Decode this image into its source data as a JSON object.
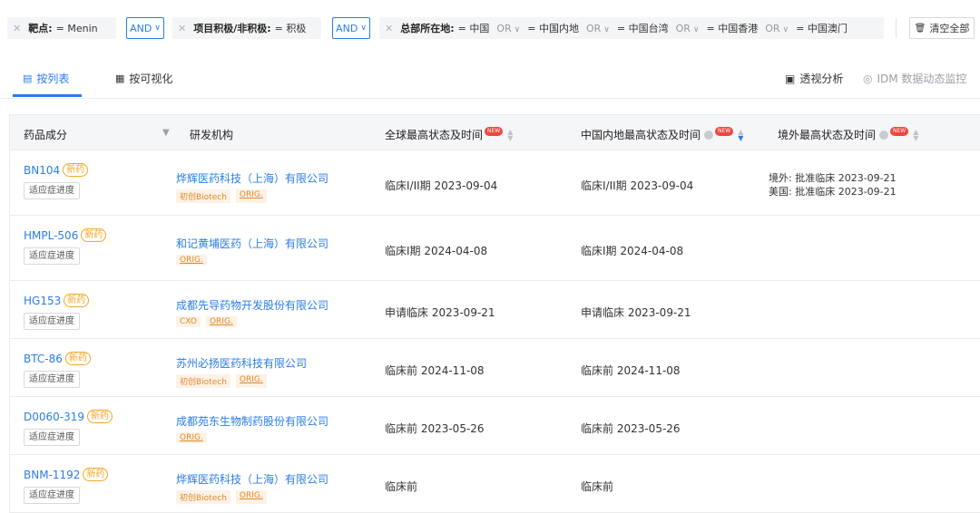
{
  "filters": {
    "target": {
      "key": "靶点:",
      "value": "= Menin"
    },
    "and1": "AND",
    "project": {
      "key": "项目积极/非积极:",
      "value": "= 积极"
    },
    "and2": "AND",
    "hq": {
      "key": "总部所在地:",
      "values": [
        "= 中国",
        "= 中国内地",
        "= 中国台湾",
        "= 中国香港",
        "= 中国澳门"
      ],
      "or_label": "OR"
    },
    "clear_label": "清空全部"
  },
  "tabs": [
    {
      "label": "按列表",
      "icon": "list-icon"
    },
    {
      "label": "按可视化",
      "icon": "grid-icon"
    }
  ],
  "tools": {
    "pivot_label": "透视分析",
    "idm_label": "IDM 数据动态监控"
  },
  "table": {
    "headers": {
      "drug": "药品成分",
      "org": "研发机构",
      "global": "全球最高状态及时间",
      "china": "中国内地最高状态及时间",
      "overseas": "境外最高状态及时间",
      "new_badge": "NEW"
    },
    "new_drug_label": "新药",
    "progress_label": "适应症进度",
    "rows": [
      {
        "drug": "BN104",
        "org": "烨辉医药科技（上海）有限公司",
        "tags": [
          "初创Biotech",
          "ORIG."
        ],
        "global": "临床I/II期 2023-09-04",
        "china": "临床I/II期 2023-09-04",
        "overseas": [
          "境外: 批准临床 2023-09-21",
          "美国: 批准临床 2023-09-21"
        ]
      },
      {
        "drug": "HMPL-506",
        "org": "和记黄埔医药（上海）有限公司",
        "tags": [
          "ORIG."
        ],
        "global": "临床I期 2024-04-08",
        "china": "临床I期 2024-04-08",
        "overseas": []
      },
      {
        "drug": "HG153",
        "org": "成都先导药物开发股份有限公司",
        "tags": [
          "CXO",
          "ORIG."
        ],
        "global": "申请临床 2023-09-21",
        "china": "申请临床 2023-09-21",
        "overseas": []
      },
      {
        "drug": "BTC-86",
        "org": "苏州必扬医药科技有限公司",
        "tags": [
          "初创Biotech",
          "ORIG."
        ],
        "global": "临床前 2024-11-08",
        "china": "临床前 2024-11-08",
        "overseas": []
      },
      {
        "drug": "D0060-319",
        "org": "成都苑东生物制药股份有限公司",
        "tags": [
          "ORIG."
        ],
        "global": "临床前 2023-05-26",
        "china": "临床前 2023-05-26",
        "overseas": []
      },
      {
        "drug": "BNM-1192",
        "org": "烨辉医药科技（上海）有限公司",
        "tags": [
          "初创Biotech",
          "ORIG."
        ],
        "global": "临床前",
        "china": "临床前",
        "overseas": []
      }
    ]
  }
}
